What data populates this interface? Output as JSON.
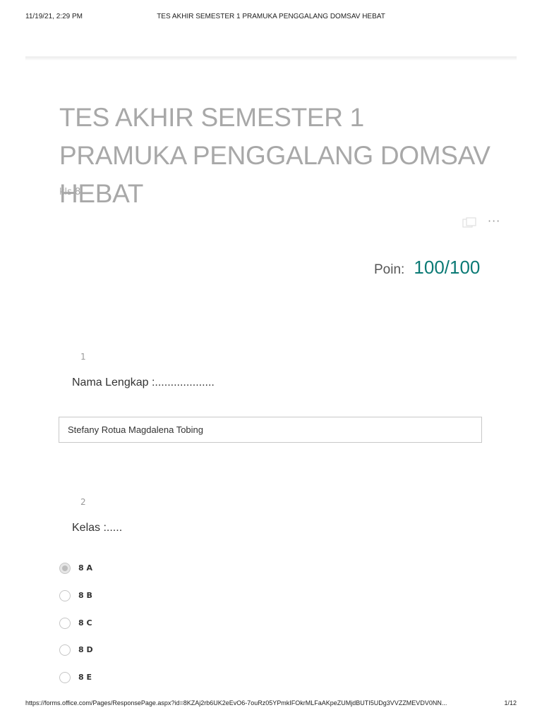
{
  "print_header": {
    "datetime": "11/19/21, 2:29 PM",
    "doc_title": "TES AKHIR SEMESTER 1 PRAMUKA PENGGALANG DOMSAV HEBAT"
  },
  "form": {
    "title": "TES AKHIR SEMESTER 1 PRAMUKA PENGGALANG DOMSAV HEBAT",
    "subtitle": "kls 8",
    "more_label": "···",
    "score_label": "Poin:",
    "score_value": "100/100"
  },
  "questions": [
    {
      "number": "1",
      "text": "Nama Lengkap :...................",
      "answer": "Stefany Rotua Magdalena Tobing"
    },
    {
      "number": "2",
      "text": "Kelas  :.....",
      "options": [
        {
          "label": "8 A",
          "selected": true
        },
        {
          "label": "8 B",
          "selected": false
        },
        {
          "label": "8 C",
          "selected": false
        },
        {
          "label": "8 D",
          "selected": false
        },
        {
          "label": "8 E",
          "selected": false
        }
      ]
    }
  ],
  "print_footer": {
    "url": "https://forms.office.com/Pages/ResponsePage.aspx?id=8KZAj2rb6UK2eEvO6-7ouRz05YPmkIFOkrMLFaAKpeZUMjdBUTI5UDg3VVZZMEVDV0NN...",
    "page": "1/12"
  },
  "colors": {
    "title": "#a8a8a8",
    "score_accent": "#0b7a75"
  }
}
